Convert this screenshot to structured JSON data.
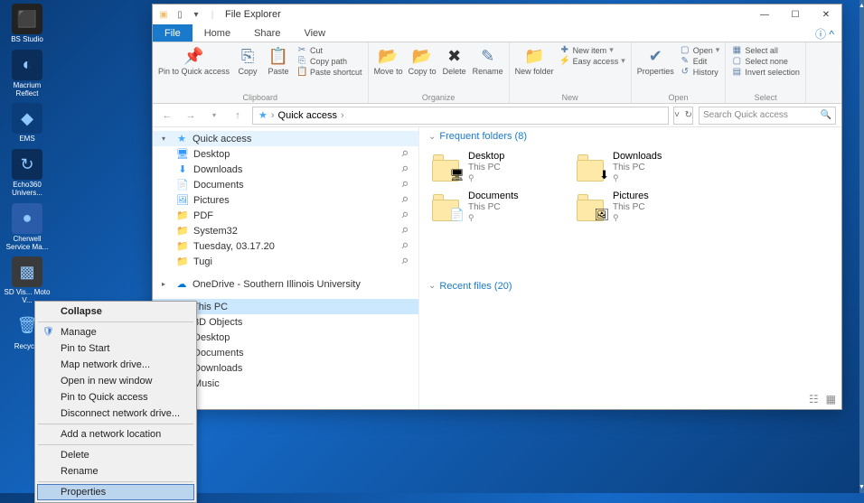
{
  "desktop": {
    "icons": [
      {
        "label": "BS Studio",
        "glyph": "⬛",
        "bg": "#222"
      },
      {
        "label": "Macrium Reflect",
        "glyph": "◐",
        "bg": "#0a2d5a"
      },
      {
        "label": "EMS",
        "glyph": "◆",
        "bg": "#0a3d7a"
      },
      {
        "label": "Echo360 Univers...",
        "glyph": "↻",
        "bg": "#0a2d5a"
      },
      {
        "label": "Cherwell Service Ma...",
        "glyph": "●",
        "bg": "#2a5caa"
      },
      {
        "label": "SD Vis... Moto V...",
        "glyph": "▩",
        "bg": "#3a3a3a"
      },
      {
        "label": "Recycle",
        "glyph": "🗑",
        "bg": "transparent"
      }
    ]
  },
  "window": {
    "title": "File Explorer",
    "tabs": {
      "file": "File",
      "home": "Home",
      "share": "Share",
      "view": "View"
    },
    "ribbon": {
      "clipboard": {
        "name": "Clipboard",
        "pin": "Pin to Quick access",
        "copy": "Copy",
        "paste": "Paste",
        "cut": "Cut",
        "copypath": "Copy path",
        "pasteshort": "Paste shortcut"
      },
      "organize": {
        "name": "Organize",
        "move": "Move to",
        "cpy": "Copy to",
        "del": "Delete",
        "ren": "Rename"
      },
      "new": {
        "name": "New",
        "folder": "New folder",
        "item": "New item",
        "easy": "Easy access"
      },
      "open": {
        "name": "Open",
        "props": "Properties",
        "open": "Open",
        "edit": "Edit",
        "hist": "History"
      },
      "select": {
        "name": "Select",
        "all": "Select all",
        "none": "Select none",
        "inv": "Invert selection"
      }
    },
    "address": {
      "path": "Quick access",
      "search_placeholder": "Search Quick access"
    },
    "nav": {
      "quick": "Quick access",
      "qitems": [
        {
          "label": "Desktop",
          "ic": "🖥",
          "c": "#3399ff",
          "pin": true
        },
        {
          "label": "Downloads",
          "ic": "⬇",
          "c": "#3399ff",
          "pin": true
        },
        {
          "label": "Documents",
          "ic": "📄",
          "c": "#3399ff",
          "pin": true
        },
        {
          "label": "Pictures",
          "ic": "🖼",
          "c": "#3399ff",
          "pin": true
        },
        {
          "label": "PDF",
          "ic": "📁",
          "c": "#ffd76a",
          "pin": false
        },
        {
          "label": "System32",
          "ic": "📁",
          "c": "#ffd76a",
          "pin": false
        },
        {
          "label": "Tuesday, 03.17.20",
          "ic": "📁",
          "c": "#ffd76a",
          "pin": false
        },
        {
          "label": "Tugi",
          "ic": "📁",
          "c": "#ffd76a",
          "pin": false
        }
      ],
      "onedrive": "OneDrive - Southern Illinois University",
      "thispc": "This PC",
      "pcitems": [
        "3D Objects",
        "Desktop",
        "Documents",
        "Downloads",
        "Music"
      ]
    },
    "content": {
      "freq_hdr": "Frequent folders (8)",
      "folders": [
        {
          "name": "Desktop",
          "sub": "This PC",
          "ov": "🖥"
        },
        {
          "name": "Downloads",
          "sub": "This PC",
          "ov": "⬇"
        },
        {
          "name": "Documents",
          "sub": "This PC",
          "ov": "📄"
        },
        {
          "name": "Pictures",
          "sub": "This PC",
          "ov": "🖼"
        }
      ],
      "recent_hdr": "Recent files (20)"
    }
  },
  "context": {
    "items": [
      {
        "label": "Collapse",
        "sep_after": true,
        "bold": true
      },
      {
        "label": "Manage",
        "icon": true
      },
      {
        "label": "Pin to Start"
      },
      {
        "label": "Map network drive..."
      },
      {
        "label": "Open in new window"
      },
      {
        "label": "Pin to Quick access"
      },
      {
        "label": "Disconnect network drive...",
        "sep_after": true
      },
      {
        "label": "Add a network location",
        "sep_after": true
      },
      {
        "label": "Delete"
      },
      {
        "label": "Rename",
        "sep_after": true
      },
      {
        "label": "Properties",
        "selected": true
      }
    ]
  }
}
